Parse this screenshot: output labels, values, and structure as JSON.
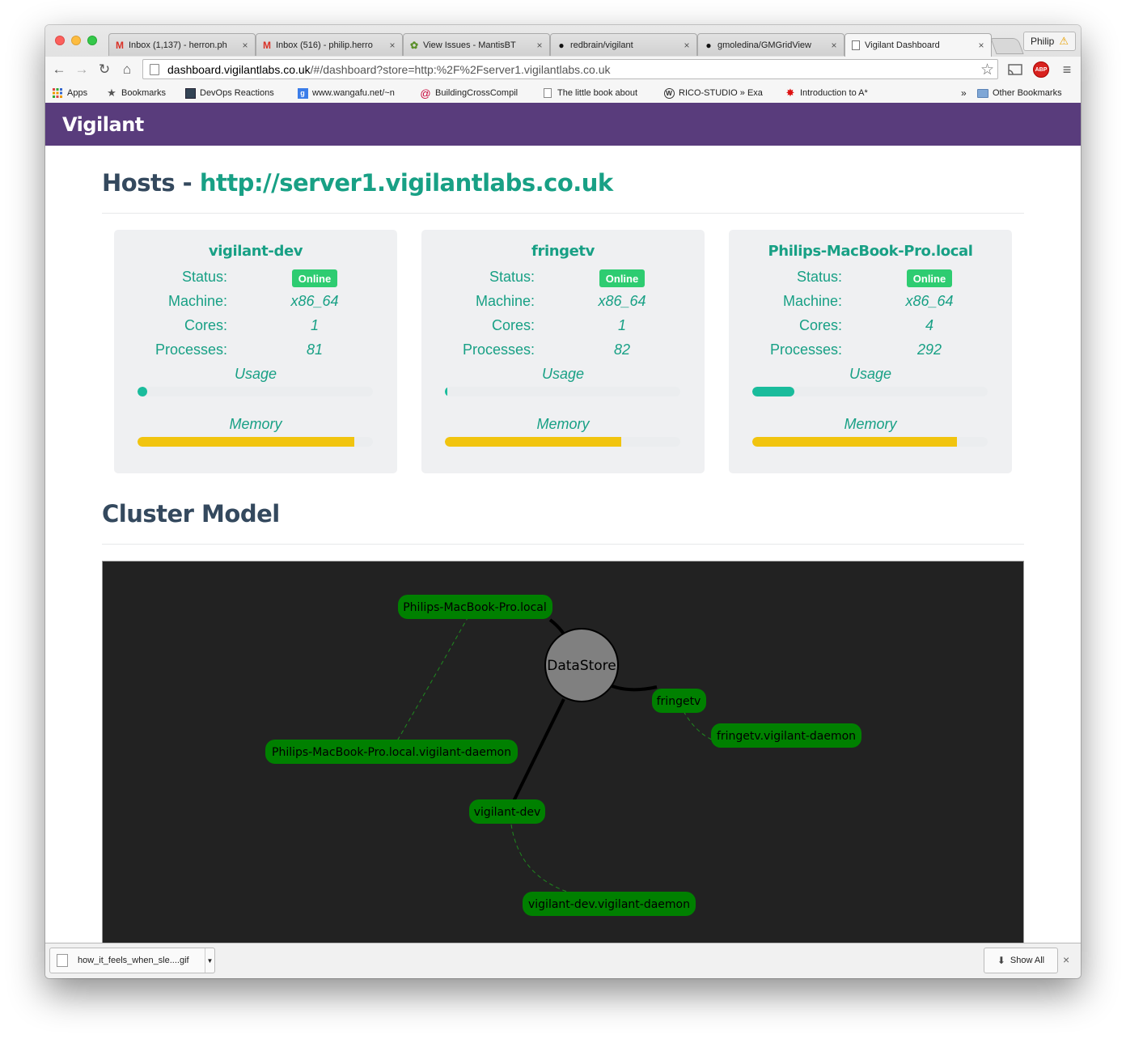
{
  "browser": {
    "tabs": [
      {
        "title": "Inbox (1,137) - herron.ph",
        "icon": "gmail-icon"
      },
      {
        "title": "Inbox (516) - philip.herro",
        "icon": "gmail-icon"
      },
      {
        "title": "View Issues - MantisBT",
        "icon": "mantis-icon"
      },
      {
        "title": "redbrain/vigilant",
        "icon": "github-icon"
      },
      {
        "title": "gmoledina/GMGridView",
        "icon": "github-icon"
      },
      {
        "title": "Vigilant Dashboard",
        "icon": "page-icon"
      }
    ],
    "close_glyph": "×",
    "profile_name": "Philip",
    "url_host": "dashboard.vigilantlabs.co.uk",
    "url_rest": "/#/dashboard?store=http:%2F%2Fserver1.vigilantlabs.co.uk",
    "bookmarks": [
      {
        "label": "Apps",
        "icon": "apps-grid-icon"
      },
      {
        "label": "Bookmarks",
        "icon": "star-icon"
      },
      {
        "label": "DevOps Reactions",
        "icon": "site-icon"
      },
      {
        "label": "www.wangafu.net/~n",
        "icon": "google-icon"
      },
      {
        "label": "BuildingCrossCompil",
        "icon": "debian-icon"
      },
      {
        "label": "The little book about",
        "icon": "page-icon"
      },
      {
        "label": "RICO-STUDIO » Exa",
        "icon": "wordpress-icon"
      },
      {
        "label": "Introduction to A*",
        "icon": "site-icon"
      }
    ],
    "bookmarks_overflow": "»",
    "other_bookmarks": "Other Bookmarks"
  },
  "app": {
    "brand": "Vigilant",
    "hosts_heading": "Hosts - ",
    "hosts_store": "http://server1.vigilantlabs.co.uk",
    "cluster_heading": "Cluster Model",
    "labels": {
      "status": "Status:",
      "machine": "Machine:",
      "cores": "Cores:",
      "processes": "Processes:",
      "usage": "Usage",
      "memory": "Memory"
    },
    "hosts": [
      {
        "name": "vigilant-dev",
        "status": "Online",
        "machine": "x86_64",
        "cores": "1",
        "processes": "81",
        "usage_pct": 4,
        "memory_pct": 92
      },
      {
        "name": "fringetv",
        "status": "Online",
        "machine": "x86_64",
        "cores": "1",
        "processes": "82",
        "usage_pct": 1,
        "memory_pct": 75
      },
      {
        "name": "Philips-MacBook-Pro.local",
        "status": "Online",
        "machine": "x86_64",
        "cores": "4",
        "processes": "292",
        "usage_pct": 18,
        "memory_pct": 87
      }
    ]
  },
  "cluster": {
    "datastore": "DataStore",
    "nodes": [
      "Philips-MacBook-Pro.local",
      "fringetv",
      "fringetv.vigilant-daemon",
      "Philips-MacBook-Pro.local.vigilant-daemon",
      "vigilant-dev",
      "vigilant-dev.vigilant-daemon"
    ],
    "colors": {
      "node": "#008000",
      "datastore": "#808080",
      "background": "#222222"
    }
  },
  "downloads": {
    "file": "how_it_feels_when_sle....gif",
    "show_all": "Show All",
    "close": "×"
  },
  "colors": {
    "accent": "#18a085",
    "navbar": "#593c7c",
    "online": "#2ecc71",
    "usage": "#1abc9c",
    "memory": "#f1c40f"
  }
}
